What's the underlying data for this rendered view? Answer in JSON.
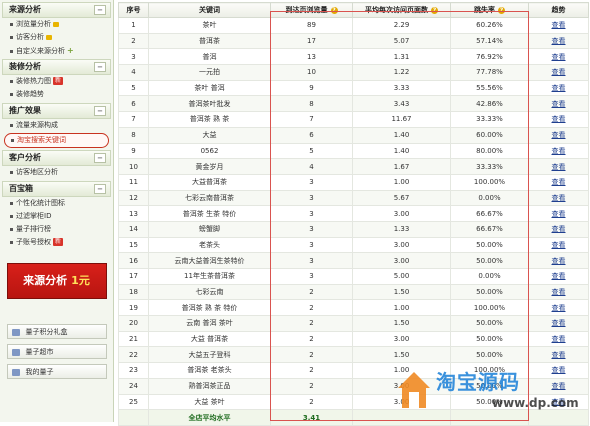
{
  "sidebar": {
    "sections": [
      {
        "title": "来源分析",
        "items": [
          {
            "label": "浏览量分析",
            "locked": true
          },
          {
            "label": "访客分析",
            "locked": true
          },
          {
            "label": "自定义来源分析",
            "plus": true
          }
        ]
      },
      {
        "title": "装修分析",
        "items": [
          {
            "label": "装修热力图",
            "badge": "新"
          },
          {
            "label": "装修趋势"
          }
        ]
      },
      {
        "title": "推广效果",
        "items": [
          {
            "label": "流量来源构成"
          },
          {
            "label": "淘宝搜索关键词",
            "active": true
          }
        ]
      },
      {
        "title": "客户分析",
        "items": [
          {
            "label": "访客地区分析"
          }
        ]
      },
      {
        "title": "百宝箱",
        "items": [
          {
            "label": "个性化统计图标"
          },
          {
            "label": "过滤掌柜ID"
          },
          {
            "label": "量子排行榜"
          },
          {
            "label": "子账号授权",
            "badge": "新"
          }
        ]
      }
    ],
    "promo": {
      "text": "来源分析",
      "price": "1元"
    },
    "bottom_buttons": [
      "量子积分礼盒",
      "量子超市",
      "我的量子"
    ]
  },
  "table": {
    "headers": [
      "序号",
      "关键词",
      "到达页浏览量",
      "平均每次访问页面数",
      "跳失率",
      "趋势"
    ],
    "rows": [
      [
        "1",
        "茶叶",
        "89",
        "2.29",
        "60.26%",
        "查看"
      ],
      [
        "2",
        "普洱茶",
        "17",
        "5.07",
        "57.14%",
        "查看"
      ],
      [
        "3",
        "普洱",
        "13",
        "1.31",
        "76.92%",
        "查看"
      ],
      [
        "4",
        "一元拍",
        "10",
        "1.22",
        "77.78%",
        "查看"
      ],
      [
        "5",
        "茶叶 普洱",
        "9",
        "3.33",
        "55.56%",
        "查看"
      ],
      [
        "6",
        "普洱茶叶批发",
        "8",
        "3.43",
        "42.86%",
        "查看"
      ],
      [
        "7",
        "普洱茶 熟 茶",
        "7",
        "11.67",
        "33.33%",
        "查看"
      ],
      [
        "8",
        "大益",
        "6",
        "1.40",
        "60.00%",
        "查看"
      ],
      [
        "9",
        "0562",
        "5",
        "1.40",
        "80.00%",
        "查看"
      ],
      [
        "10",
        "黄金岁月",
        "4",
        "1.67",
        "33.33%",
        "查看"
      ],
      [
        "11",
        "大益普洱茶",
        "3",
        "1.00",
        "100.00%",
        "查看"
      ],
      [
        "12",
        "七彩云南普洱茶",
        "3",
        "5.67",
        "0.00%",
        "查看"
      ],
      [
        "13",
        "普洱茶 生茶 特价",
        "3",
        "3.00",
        "66.67%",
        "查看"
      ],
      [
        "14",
        "螃蟹脚",
        "3",
        "1.33",
        "66.67%",
        "查看"
      ],
      [
        "15",
        "老茶头",
        "3",
        "3.00",
        "50.00%",
        "查看"
      ],
      [
        "16",
        "云南大益普洱生茶特价",
        "3",
        "3.00",
        "50.00%",
        "查看"
      ],
      [
        "17",
        "11年生茶普洱茶",
        "3",
        "5.00",
        "0.00%",
        "查看"
      ],
      [
        "18",
        "七彩云南",
        "2",
        "1.50",
        "50.00%",
        "查看"
      ],
      [
        "19",
        "普洱茶 熟 茶 特价",
        "2",
        "1.00",
        "100.00%",
        "查看"
      ],
      [
        "20",
        "云南 普洱 茶叶",
        "2",
        "1.50",
        "50.00%",
        "查看"
      ],
      [
        "21",
        "大益 普洱茶",
        "2",
        "3.00",
        "50.00%",
        "查看"
      ],
      [
        "22",
        "大益五子登科",
        "2",
        "1.50",
        "50.00%",
        "查看"
      ],
      [
        "23",
        "普洱茶 老茶头",
        "2",
        "1.00",
        "100.00%",
        "查看"
      ],
      [
        "24",
        "熟普洱茶正品",
        "2",
        "3.00",
        "50.00%",
        "查看"
      ],
      [
        "25",
        "大益 茶叶",
        "2",
        "3.00",
        "50.00%",
        "查看"
      ]
    ],
    "footer": [
      "",
      "全店平均水平",
      "3.41",
      "",
      "",
      ""
    ]
  },
  "watermark": {
    "text": "淘宝源码",
    "url": "www.dp.com"
  },
  "colors": {
    "accent_red": "#d9534f",
    "link_blue": "#1f3f8f",
    "sidebar_bg": "#f3f6ee",
    "promo_red": "#d8201a"
  }
}
